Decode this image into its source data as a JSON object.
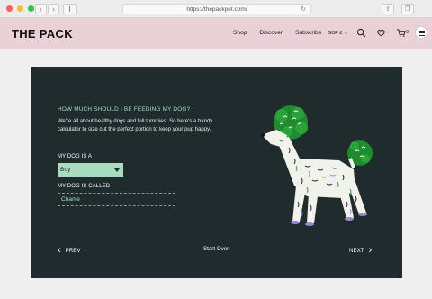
{
  "browser": {
    "url": "https://thepackpet.com/",
    "traffic_light_colors": [
      "#fe5f57",
      "#febc2e",
      "#28c840"
    ]
  },
  "header": {
    "logo": "THE PACK",
    "nav": [
      "Shop",
      "Discover",
      "Subscribe"
    ],
    "currency": "GBP £",
    "cart_count": "0",
    "background_color": "#ead0d7"
  },
  "calculator": {
    "question": "HOW MUCH SHOULD I BE FEEDING MY DOG?",
    "intro": "We're all about healthy dogs and full tummies. So here's a handy calculator to size out the perfect portion to keep your pup happy.",
    "dog_is_label": "MY DOG IS A",
    "dog_is_value": "Boy",
    "dog_name_label": "MY DOG IS CALLED",
    "dog_name_value": "Charlie",
    "prev_label": "PREV",
    "start_over_label": "Start Over",
    "next_label": "NEXT",
    "panel_color": "#1f2b2c",
    "accent_color": "#a9dcc1"
  }
}
